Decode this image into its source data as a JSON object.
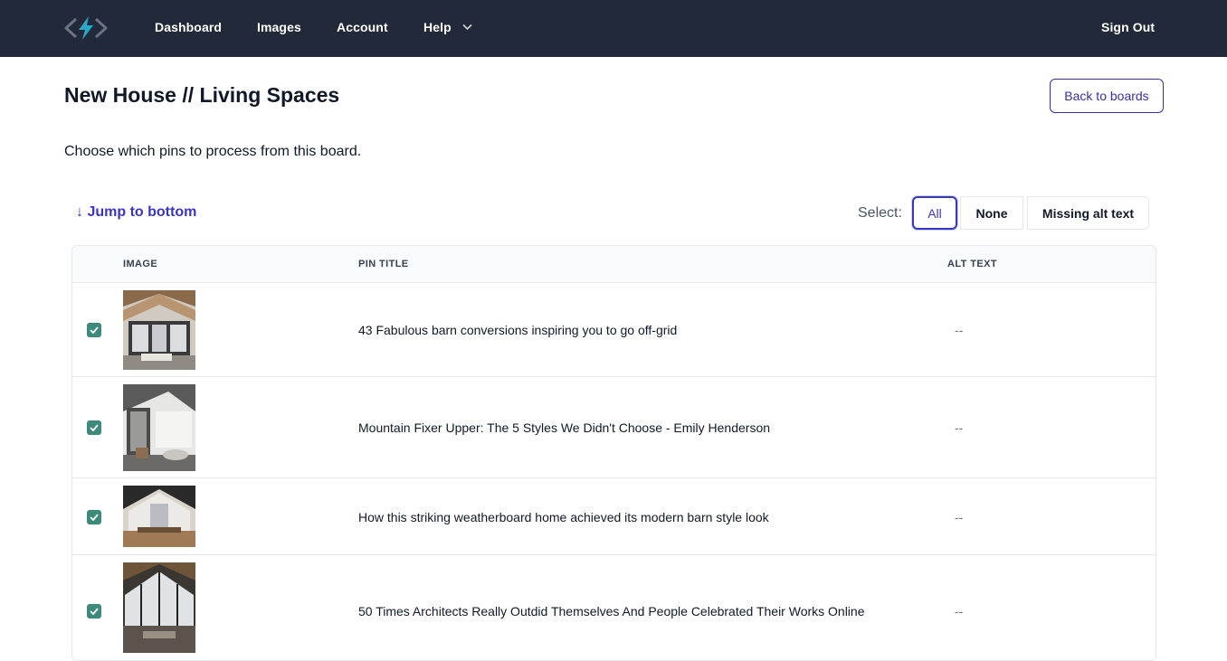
{
  "nav": {
    "logo_icon": "bolt-brackets-logo-icon",
    "links": [
      "Dashboard",
      "Images",
      "Account",
      "Help"
    ],
    "sign_out": "Sign Out",
    "colors": {
      "bar": "#222938",
      "logo_accent": "#2ba7c8"
    }
  },
  "header": {
    "title": "New House // Living Spaces",
    "back_button": "Back to boards",
    "intro": "Choose which pins to process from this board."
  },
  "controls": {
    "jump": "↓ Jump to bottom",
    "select_label": "Select:",
    "options": [
      "All",
      "None",
      "Missing alt text"
    ],
    "selected": "All"
  },
  "table": {
    "columns": [
      "IMAGE",
      "PIN TITLE",
      "ALT TEXT"
    ],
    "rows": [
      {
        "checked": true,
        "title": "43 Fabulous barn conversions inspiring you to go off-grid",
        "alt": "--"
      },
      {
        "checked": true,
        "title": "Mountain Fixer Upper: The 5 Styles We Didn't Choose - Emily Henderson",
        "alt": "--"
      },
      {
        "checked": true,
        "title": "How this striking weatherboard home achieved its modern barn style look",
        "alt": "--"
      },
      {
        "checked": true,
        "title": "50 Times Architects Really Outdid Themselves And People Celebrated Their Works Online",
        "alt": "--"
      }
    ]
  }
}
